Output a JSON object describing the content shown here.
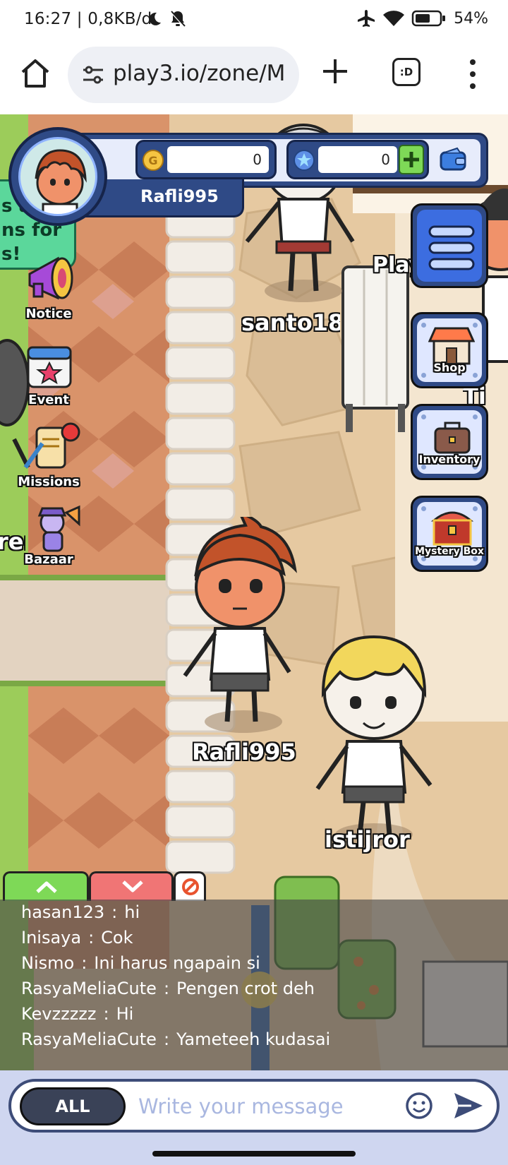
{
  "status_bar": {
    "time": "16:27 | 0,8KB/d",
    "battery": "54%"
  },
  "browser": {
    "url": "play3.io/zone/M",
    "tabs_label": ":D"
  },
  "hud": {
    "player_name": "Rafli995",
    "coins": "0",
    "gems": "0",
    "notice_bubble_lines": [
      "s a",
      "ns for",
      "s!"
    ]
  },
  "side_menu": {
    "notice": "Notice",
    "event": "Event",
    "missions": "Missions",
    "bazaar": "Bazaar"
  },
  "right_menu": {
    "shop": "Shop",
    "inventory": "Inventory",
    "mystery_box": "Mystery Box"
  },
  "world": {
    "names": {
      "santo": "santo18",
      "player": "Rafli995",
      "istijror": "istijror",
      "partial_left": "ren",
      "partial_right": "Ti",
      "partial_top_right": "Player"
    }
  },
  "chat": {
    "messages": [
      {
        "user": "hasan123",
        "text": "hi"
      },
      {
        "user": "Inisaya",
        "text": "Cok"
      },
      {
        "user": "Nismo",
        "text": "Ini harus ngapain si"
      },
      {
        "user": "RasyaMeliaCute",
        "text": "Pengen crot deh"
      },
      {
        "user": "Kevzzzzz",
        "text": "Hi"
      },
      {
        "user": "RasyaMeliaCute",
        "text": "Yameteeh kudasai"
      }
    ],
    "separator": ":",
    "channel": "ALL",
    "placeholder": "Write your message"
  },
  "colors": {
    "hud_blue": "#2f4a86",
    "chat_green_tab": "#7ed957",
    "chat_red_tab": "#f07575"
  }
}
